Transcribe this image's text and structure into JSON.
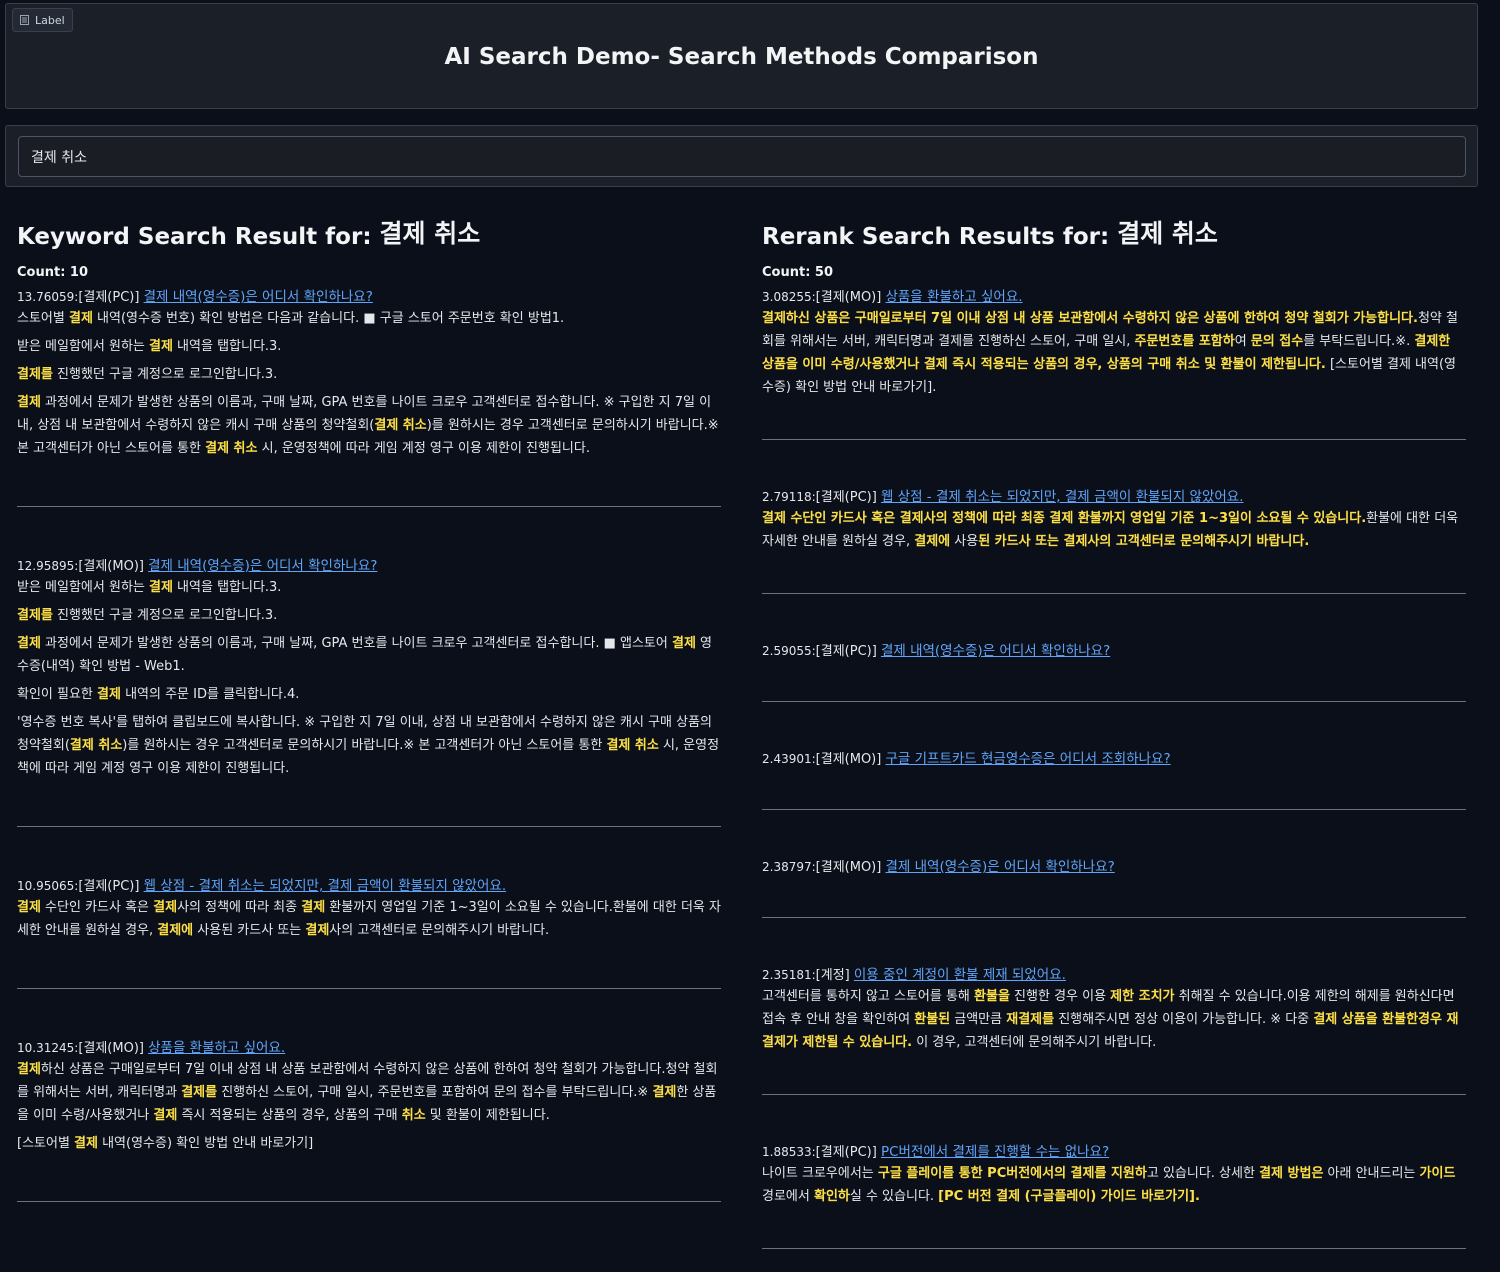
{
  "header": {
    "label_tag": "Label",
    "title": "AI Search Demo- Search Methods Comparison"
  },
  "search": {
    "value": "결제 취소"
  },
  "keyword": {
    "title_prefix": "Keyword Search Result for:",
    "query": "결제 취소",
    "count_label": "Count: 10",
    "results": [
      {
        "score": "13.76059:",
        "category": "[결제(PC)]",
        "link": "결제 내역(영수증)은 어디서 확인하나요?",
        "paragraphs": [
          [
            [
              "스토어별 ",
              0
            ],
            [
              "결제",
              1
            ],
            [
              " 내역(영수증 번호) 확인 방법은 다음과 같습니다. ■ 구글 스토어 주문번호 확인 방법1.",
              0
            ]
          ],
          [
            [
              "받은 메일함에서 원하는 ",
              0
            ],
            [
              "결제",
              1
            ],
            [
              " 내역을 탭합니다.3.",
              0
            ]
          ],
          [
            [
              "결제를",
              1
            ],
            [
              " 진행했던 구글 계정으로 로그인합니다.3.",
              0
            ]
          ],
          [
            [
              "결제",
              1
            ],
            [
              " 과정에서 문제가 발생한 상품의 이름과, 구매 날짜, GPA 번호를 나이트 크로우 고객센터로 접수합니다. ※ 구입한 지 7일 이내, 상점 내 보관함에서 수령하지 않은 캐시 구매 상품의 청약철회(",
              0
            ],
            [
              "결제 취소",
              1
            ],
            [
              ")를 원하시는 경우 고객센터로 문의하시기 바랍니다.※ 본 고객센터가 아닌 스토어를 통한 ",
              0
            ],
            [
              "결제 취소",
              1
            ],
            [
              " 시, 운영정책에 따라 게임 계정 영구 이용 제한이 진행됩니다.",
              0
            ]
          ]
        ]
      },
      {
        "score": "12.95895:",
        "category": "[결제(MO)]",
        "link": "결제 내역(영수증)은 어디서 확인하나요?",
        "paragraphs": [
          [
            [
              "받은 메일함에서 원하는 ",
              0
            ],
            [
              "결제",
              1
            ],
            [
              " 내역을 탭합니다.3.",
              0
            ]
          ],
          [
            [
              "결제를",
              1
            ],
            [
              " 진행했던 구글 계정으로 로그인합니다.3.",
              0
            ]
          ],
          [
            [
              "결제",
              1
            ],
            [
              " 과정에서 문제가 발생한 상품의 이름과, 구매 날짜, GPA 번호를 나이트 크로우 고객센터로 접수합니다. ■ 앱스토어 ",
              0
            ],
            [
              "결제",
              1
            ],
            [
              " 영수증(내역) 확인 방법 - Web1.",
              0
            ]
          ],
          [
            [
              "확인이 필요한 ",
              0
            ],
            [
              "결제",
              1
            ],
            [
              " 내역의 주문 ID를 클릭합니다.4.",
              0
            ]
          ],
          [
            [
              "'영수증 번호 복사'를 탭하여 클립보드에 복사합니다. ※ 구입한 지 7일 이내, 상점 내 보관함에서 수령하지 않은 캐시 구매 상품의 청약철회(",
              0
            ],
            [
              "결제 취소",
              1
            ],
            [
              ")를 원하시는 경우 고객센터로 문의하시기 바랍니다.※ 본 고객센터가 아닌 스토어를 통한 ",
              0
            ],
            [
              "결제 취소",
              1
            ],
            [
              " 시, 운영정책에 따라 게임 계정 영구 이용 제한이 진행됩니다.",
              0
            ]
          ]
        ]
      },
      {
        "score": "10.95065:",
        "category": "[결제(PC)]",
        "link": "웹 상점 - 결제 취소는 되었지만, 결제 금액이 환불되지 않았어요.",
        "paragraphs": [
          [
            [
              "결제",
              1
            ],
            [
              " 수단인 카드사 혹은 ",
              0
            ],
            [
              "결제",
              1
            ],
            [
              "사의 정책에 따라 최종 ",
              0
            ],
            [
              "결제",
              1
            ],
            [
              " 환불까지 영업일 기준 1~3일이 소요될 수 있습니다.환불에 대한 더욱 자세한 안내를 원하실 경우, ",
              0
            ],
            [
              "결제에",
              1
            ],
            [
              " 사용된 카드사 또는 ",
              0
            ],
            [
              "결제",
              1
            ],
            [
              "사의 고객센터로 문의해주시기 바랍니다.",
              0
            ]
          ]
        ]
      },
      {
        "score": "10.31245:",
        "category": "[결제(MO)]",
        "link": "상품을 환불하고 싶어요.",
        "paragraphs": [
          [
            [
              "결제",
              1
            ],
            [
              "하신 상품은 구매일로부터 7일 이내 상점 내 상품 보관함에서 수령하지 않은 상품에 한하여 청약 철회가 가능합니다.청약 철회를 위해서는 서버, 캐릭터명과 ",
              0
            ],
            [
              "결제를",
              1
            ],
            [
              " 진행하신 스토어, 구매 일시, 주문번호를 포함하여 문의 접수를 부탁드립니다.※ ",
              0
            ],
            [
              "결제",
              1
            ],
            [
              "한 상품을 이미 수령/사용했거나 ",
              0
            ],
            [
              "결제",
              1
            ],
            [
              " 즉시 적용되는 상품의 경우, 상품의 구매 ",
              0
            ],
            [
              "취소",
              1
            ],
            [
              " 및 환불이 제한됩니다.",
              0
            ]
          ],
          [
            [
              "[스토어별 ",
              0
            ],
            [
              "결제",
              1
            ],
            [
              " 내역(영수증) 확인 방법 안내 바로가기]",
              0
            ]
          ]
        ]
      }
    ]
  },
  "rerank": {
    "title_prefix": "Rerank Search Results for:",
    "query": "결제 취소",
    "count_label": "Count: 50",
    "results": [
      {
        "score": "3.08255:",
        "category": "[결제(MO)]",
        "link": "상품을 환불하고 싶어요.",
        "paragraphs": [
          [
            [
              "결제하신 상품은 구매일로부터 7일 이내 상점 내 상품 보관함에서 수령하지 않은 상품에 한하여 청약 철회가 가능합니다.",
              1
            ],
            [
              "청약 철회를 위해서는 서버, 캐릭터명과 결제를 진행하신 스토어, 구매 일시, ",
              0
            ],
            [
              "주문번호를 포함하",
              1
            ],
            [
              "여 ",
              0
            ],
            [
              "문의 접수",
              1
            ],
            [
              "를 부탁드립니다.※. ",
              0
            ],
            [
              "결제한 상품을 이미 수령/사용했거나 결제 즉시 적용되는 상품의 경우, 상품의 구매 취소 및 환불이 제한됩니다.",
              1
            ],
            [
              " [스토어별 결제 내역(영수증) 확인 방법 안내 바로가기].",
              0
            ]
          ]
        ]
      },
      {
        "score": "2.79118:",
        "category": "[결제(PC)]",
        "link": "웹 상점 - 결제 취소는 되었지만, 결제 금액이 환불되지 않았어요.",
        "paragraphs": [
          [
            [
              "결제 수단인 카드사 혹은 결제사의 정책에 따라 최종 결제 환불까지 영업일 기준 1~3일이 소요될 수 있습니다.",
              1
            ],
            [
              "환불에 대한 더욱 자세한 안내를 원하실 경우, ",
              0
            ],
            [
              "결제에",
              1
            ],
            [
              " 사용",
              0
            ],
            [
              "된 카드사 또는 결제사의 고객센터로 문의해주시기 바랍니다.",
              1
            ]
          ]
        ]
      },
      {
        "score": "2.59055:",
        "category": "[결제(PC)]",
        "link": "결제 내역(영수증)은 어디서 확인하나요?",
        "paragraphs": []
      },
      {
        "score": "2.43901:",
        "category": "[결제(MO)]",
        "link": "구글 기프트카드 현금영수증은 어디서 조회하나요?",
        "paragraphs": []
      },
      {
        "score": "2.38797:",
        "category": "[결제(MO)]",
        "link": "결제 내역(영수증)은 어디서 확인하나요?",
        "paragraphs": []
      },
      {
        "score": "2.35181:",
        "category": "[계정]",
        "link": "이용 중인 계정이 환불 제재 되었어요.",
        "paragraphs": [
          [
            [
              "고객센터를 통하지 않고 스토어를 통해 ",
              0
            ],
            [
              "환불을",
              1
            ],
            [
              " 진행한 경우 이용 ",
              0
            ],
            [
              "제한 조치가",
              1
            ],
            [
              " 취해질 수 있습니다.이용 제한의 해제를 원하신다면 접속 후 안내 창을 확인하여 ",
              0
            ],
            [
              "환불된",
              1
            ],
            [
              " 금액만큼 ",
              0
            ],
            [
              "재결제를",
              1
            ],
            [
              " 진행해주시면 정상 이용이 가능합니다. ※ 다중 ",
              0
            ],
            [
              "결제 상품을 환불한경우 재결제가 제한될 수 있습니다.",
              1
            ],
            [
              " 이 경우, 고객센터에 문의해주시기 바랍니다.",
              0
            ]
          ]
        ]
      },
      {
        "score": "1.88533:",
        "category": "[결제(PC)]",
        "link": "PC버전에서 결제를 진행할 수는 없나요?",
        "paragraphs": [
          [
            [
              "나이트 크로우에서는 ",
              0
            ],
            [
              "구글 플레이를 통한 PC버전에서의 결제를 지원하",
              1
            ],
            [
              "고 있습니다. 상세한 ",
              0
            ],
            [
              "결제 방법은",
              1
            ],
            [
              " 아래 안내드리는 ",
              0
            ],
            [
              "가이드",
              1
            ],
            [
              " 경로에서 ",
              0
            ],
            [
              "확인하",
              1
            ],
            [
              "실 수 있습니다. ",
              0
            ],
            [
              "[PC 버전 결제 (구글플레이) 가이드 바로가기].",
              1
            ]
          ]
        ]
      }
    ]
  }
}
